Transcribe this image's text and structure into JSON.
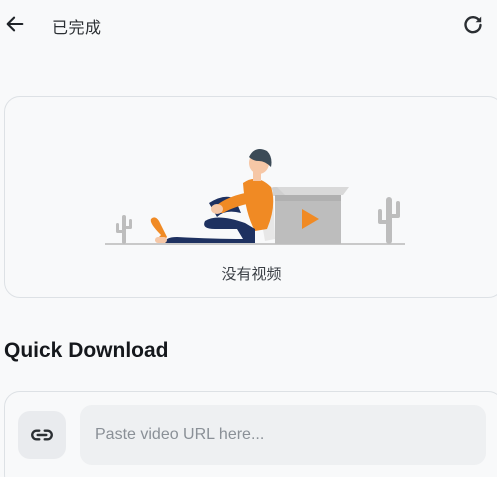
{
  "app_bar": {
    "title": "已完成",
    "back_icon": "arrow-left-icon",
    "refresh_icon": "refresh-icon"
  },
  "empty_state": {
    "illustration": "person-sitting-with-video-box-illustration",
    "text": "没有视频"
  },
  "quick_download": {
    "title": "Quick Download",
    "link_icon": "link-icon",
    "url_placeholder": "Paste video URL here...",
    "url_value": ""
  },
  "colors": {
    "background": "#f8f9fa",
    "accent_orange": "#f08a24",
    "card_border": "#dde1e5"
  }
}
